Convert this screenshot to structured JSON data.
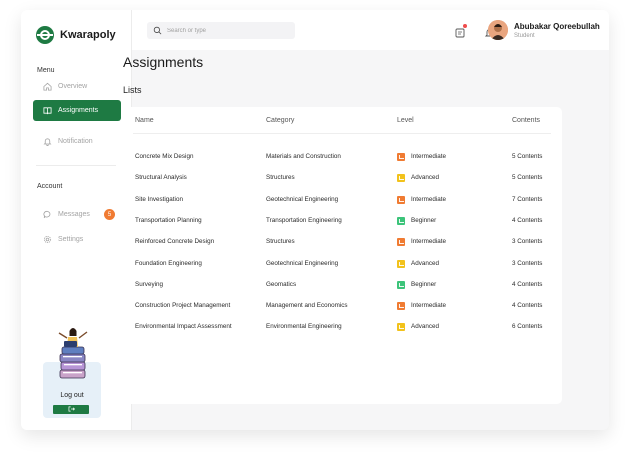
{
  "app": {
    "name": "Kwarapoly"
  },
  "sidebar": {
    "menu_label": "Menu",
    "items": [
      {
        "label": "Overview"
      },
      {
        "label": "Assignments"
      },
      {
        "label": "Notification"
      }
    ],
    "account_label": "Account",
    "account_items": [
      {
        "label": "Messages",
        "badge": "5"
      },
      {
        "label": "Settings"
      }
    ],
    "logout": {
      "label": "Log out",
      "button_icon": "logout-icon"
    }
  },
  "topbar": {
    "search": {
      "placeholder": "Search or type"
    },
    "user": {
      "name": "Abubakar Qoreebullah",
      "role": "Student"
    }
  },
  "main": {
    "title": "Assignments",
    "section_label": "Lists",
    "columns": [
      "Name",
      "Category",
      "Level",
      "Contents"
    ],
    "rows": [
      {
        "name": "Concrete Mix Design",
        "category": "Materials and Construction",
        "level": "Intermediate",
        "contents": "5 Contents"
      },
      {
        "name": "Structural Analysis",
        "category": "Structures",
        "level": "Advanced",
        "contents": "5 Contents"
      },
      {
        "name": "Site Investigation",
        "category": "Geotechnical Engineering",
        "level": "Intermediate",
        "contents": "7 Contents"
      },
      {
        "name": "Transportation Planning",
        "category": "Transportation Engineering",
        "level": "Beginner",
        "contents": "4 Contents"
      },
      {
        "name": "Reinforced Concrete Design",
        "category": "Structures",
        "level": "Intermediate",
        "contents": "3 Contents"
      },
      {
        "name": "Foundation Engineering",
        "category": "Geotechnical Engineering",
        "level": "Advanced",
        "contents": "3 Contents"
      },
      {
        "name": "Surveying",
        "category": "Geomatics",
        "level": "Beginner",
        "contents": "4 Contents"
      },
      {
        "name": "Construction Project Management",
        "category": "Management and Economics",
        "level": "Intermediate",
        "contents": "4 Contents"
      },
      {
        "name": "Environmental Impact Assessment",
        "category": "Environmental Engineering",
        "level": "Advanced",
        "contents": "6 Contents"
      }
    ]
  },
  "colors": {
    "brand": "#1e7a43",
    "intermediate": "#f07b32",
    "advanced": "#f2c21b",
    "beginner": "#3cc47a",
    "badge": "#f07b32"
  }
}
